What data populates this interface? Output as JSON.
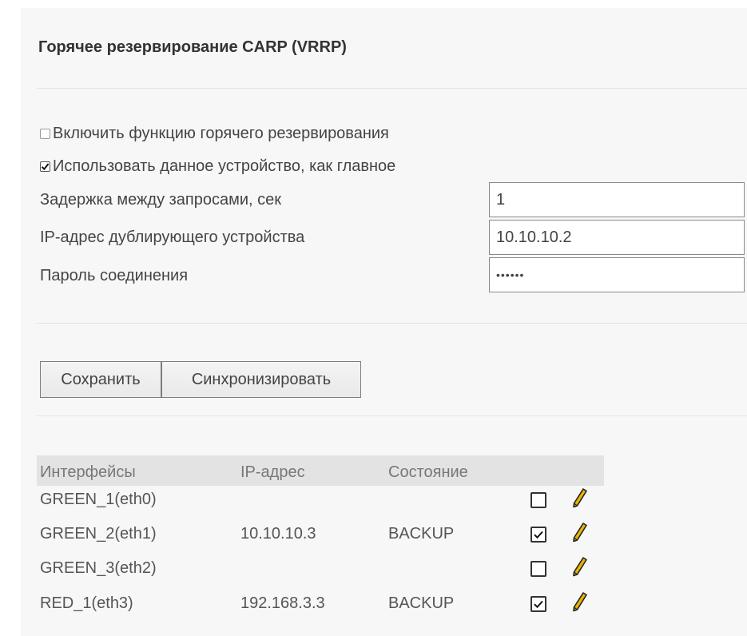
{
  "section_title": "Горячее резервирование CARP (VRRP)",
  "options": {
    "enable_label": "Включить функцию горячего резервирования",
    "enable_checked": false,
    "master_label": "Использовать данное устройство, как главное",
    "master_checked": true
  },
  "fields": {
    "delay_label": "Задержка между запросами, сек",
    "delay_value": "1",
    "backup_ip_label": "IP-адрес дублирующего устройства",
    "backup_ip_value": "10.10.10.2",
    "password_label": "Пароль соединения",
    "password_value": "••••••"
  },
  "buttons": {
    "save": "Сохранить",
    "sync": "Синхронизировать"
  },
  "table": {
    "headers": [
      "Интерфейсы",
      "IP-адрес",
      "Состояние"
    ],
    "rows": [
      {
        "interface": "GREEN_1(eth0)",
        "ip": "",
        "state": "",
        "checked": false
      },
      {
        "interface": "GREEN_2(eth1)",
        "ip": "10.10.10.3",
        "state": "BACKUP",
        "checked": true
      },
      {
        "interface": "GREEN_3(eth2)",
        "ip": "",
        "state": "",
        "checked": false
      },
      {
        "interface": "RED_1(eth3)",
        "ip": "192.168.3.3",
        "state": "BACKUP",
        "checked": true
      }
    ]
  },
  "icons": {
    "checkmark": "check-icon",
    "edit": "pencil-icon",
    "pencil_color": "#e8b400"
  }
}
